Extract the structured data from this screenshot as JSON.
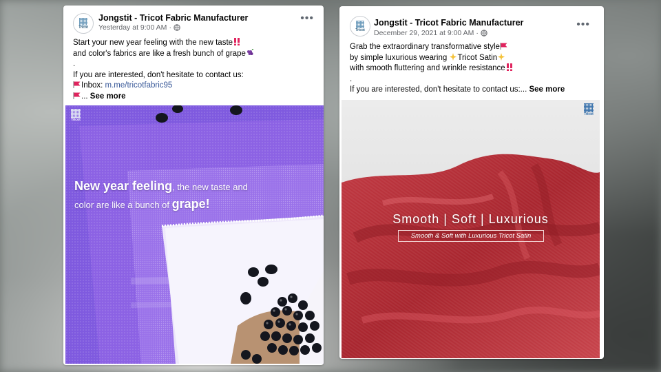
{
  "posts": [
    {
      "page_name": "Jongstit - Tricot Fabric Manufacturer",
      "timestamp": "Yesterday at 9:00 AM",
      "avatar_text": "Tricot",
      "more_label": "•••",
      "lines": [
        "Start your new year feeling with the new taste",
        "and color's fabrics are like a fresh bunch of grape",
        ".",
        "If you are interested, don't hesitate to contact us:",
        "Inbox: ",
        "... "
      ],
      "link": "m.me/tricotfabric95",
      "see_more": "See more",
      "image": {
        "logo_text": "Tricot",
        "caption_bold1": "New year feeling",
        "caption_rest1": ", the new taste and",
        "caption_rest2": "color are like a bunch of ",
        "caption_bold2": "grape!"
      }
    },
    {
      "page_name": "Jongstit - Tricot Fabric Manufacturer",
      "timestamp": "December 29, 2021 at 9:00 AM",
      "avatar_text": "Tricot",
      "more_label": "•••",
      "lines": [
        "Grab the extraordinary transformative style",
        "by simple luxurious wearing ",
        "Tricot Satin",
        "with smooth fluttering and wrinkle resistance",
        ".",
        "If you are interested, don't hesitate to contact us:... "
      ],
      "see_more": "See more",
      "image": {
        "logo_text": "Tricot",
        "title": "Smooth | Soft | Luxurious",
        "subtitle": "Smooth & Soft with Luxurious Tricot Satin"
      }
    }
  ],
  "icons": [
    "globe-icon",
    "red-double-exclamation-icon",
    "grape-icon",
    "red-flag-icon",
    "sparkles-icon",
    "more-options-icon"
  ],
  "colors": {
    "link": "#385898",
    "meta": "#65676b",
    "purple": "#7b5ad8",
    "satin_red": "#b8333c"
  }
}
